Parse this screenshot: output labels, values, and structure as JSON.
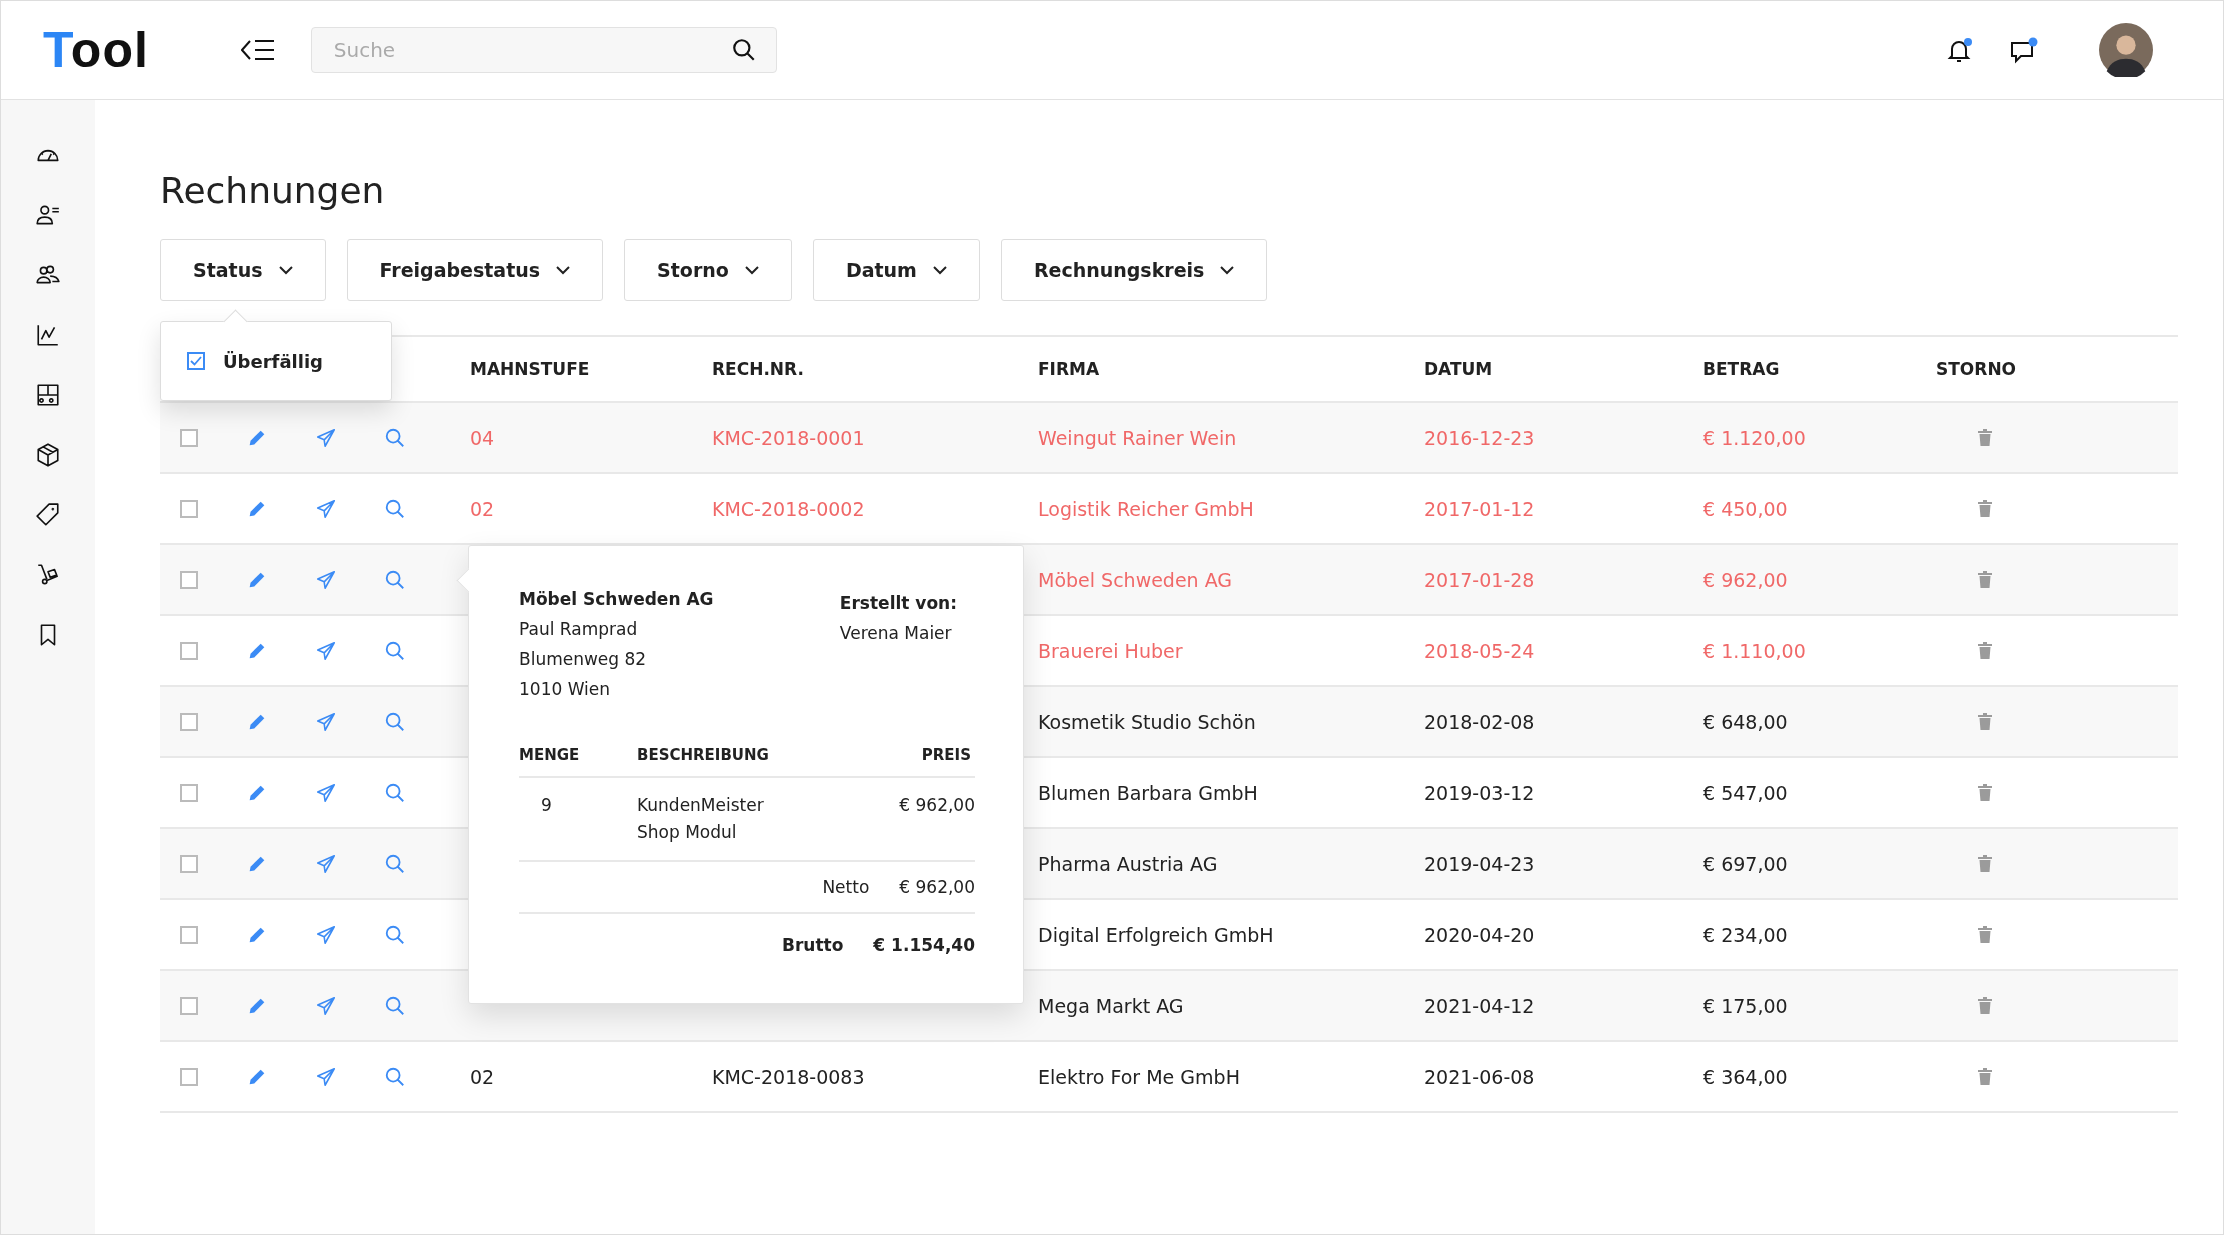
{
  "header": {
    "logo": "Tool",
    "search": {
      "placeholder": "Suche"
    }
  },
  "page_title": "Rechnungen",
  "filters": [
    {
      "label": "Status",
      "options": [
        {
          "label": "Überfällig",
          "checked": true
        }
      ]
    },
    {
      "label": "Freigabestatus"
    },
    {
      "label": "Storno"
    },
    {
      "label": "Datum"
    },
    {
      "label": "Rechnungskreis"
    }
  ],
  "table": {
    "columns": [
      "MAHNSTUFE",
      "RECH.NR.",
      "FIRMA",
      "DATUM",
      "BETRAG",
      "STORNO"
    ],
    "rows": [
      {
        "checked": false,
        "overdue": true,
        "mahnstufe": "04",
        "rech_nr": "KMC-2018-0001",
        "firma": "Weingut Rainer Wein",
        "datum": "2016-12-23",
        "betrag": "€ 1.120,00"
      },
      {
        "checked": false,
        "overdue": true,
        "mahnstufe": "02",
        "rech_nr": "KMC-2018-0002",
        "firma": "Logistik Reicher GmbH",
        "datum": "2017-01-12",
        "betrag": "€ 450,00"
      },
      {
        "checked": false,
        "overdue": true,
        "firma": "Möbel Schweden AG",
        "datum": "2017-01-28",
        "betrag": "€ 962,00",
        "preview": {
          "company": "Möbel Schweden AG",
          "address": [
            "Paul Ramprad",
            "Blumenweg 82",
            "1010 Wien"
          ],
          "created_by_label": "Erstellt von:",
          "created_by": "Verena Maier",
          "columns": [
            "MENGE",
            "BESCHREIBUNG",
            "PREIS"
          ],
          "items": [
            {
              "menge": "9",
              "beschreibung": "KundenMeister Shop Modul",
              "preis": "€ 962,00"
            }
          ],
          "netto_label": "Netto",
          "netto": "€ 962,00",
          "brutto_label": "Brutto",
          "brutto": "€ 1.154,40"
        }
      },
      {
        "checked": false,
        "overdue": true,
        "firma": "Brauerei Huber",
        "datum": "2018-05-24",
        "betrag": "€ 1.110,00"
      },
      {
        "checked": false,
        "overdue": false,
        "firma": "Kosmetik Studio Schön",
        "datum": "2018-02-08",
        "betrag": "€ 648,00"
      },
      {
        "checked": false,
        "overdue": false,
        "firma": "Blumen Barbara GmbH",
        "datum": "2019-03-12",
        "betrag": "€ 547,00"
      },
      {
        "checked": false,
        "overdue": false,
        "firma": "Pharma Austria AG",
        "datum": "2019-04-23",
        "betrag": "€ 697,00"
      },
      {
        "checked": false,
        "overdue": false,
        "firma": "Digital Erfolgreich GmbH",
        "datum": "2020-04-20",
        "betrag": "€ 234,00"
      },
      {
        "checked": false,
        "overdue": false,
        "firma": "Mega Markt AG",
        "datum": "2021-04-12",
        "betrag": "€ 175,00"
      },
      {
        "checked": false,
        "overdue": false,
        "mahnstufe": "02",
        "rech_nr": "KMC-2018-0083",
        "firma": "Elektro For Me GmbH",
        "datum": "2021-06-08",
        "betrag": "€ 364,00"
      }
    ]
  }
}
